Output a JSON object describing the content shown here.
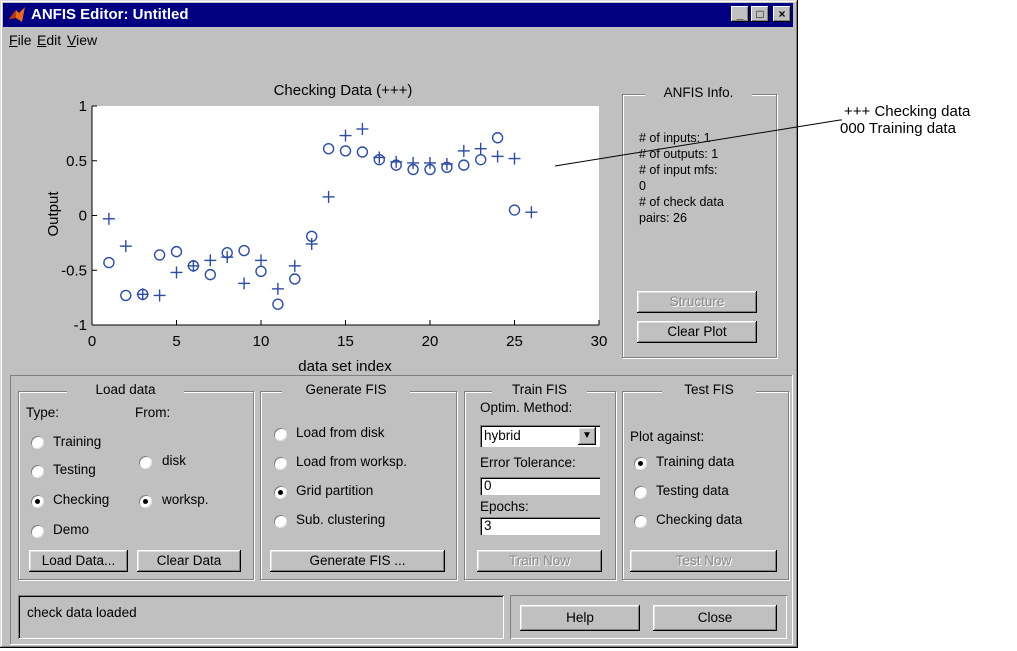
{
  "window": {
    "title": "ANFIS Editor: Untitled",
    "controls": [
      "_",
      "□",
      "×"
    ]
  },
  "menu": {
    "items": [
      "File",
      "Edit",
      "View"
    ]
  },
  "chart_data": {
    "type": "scatter",
    "title": "Checking Data (+++)",
    "xlabel": "data set index",
    "ylabel": "Output",
    "xlim": [
      0,
      30
    ],
    "ylim": [
      -1,
      1
    ],
    "xticks": [
      "0",
      "5",
      "10",
      "15",
      "20",
      "25",
      "30"
    ],
    "yticks": [
      "1",
      "0.5",
      "0",
      "-0.5",
      "-1"
    ],
    "series": [
      {
        "marker": "o",
        "x": [
          1,
          2,
          3,
          4,
          5,
          6,
          7,
          8,
          9,
          10,
          11,
          12,
          13,
          14,
          15,
          16,
          17,
          18,
          19,
          20,
          21,
          22,
          23,
          24,
          25
        ],
        "y": [
          -0.43,
          -0.73,
          -0.72,
          -0.36,
          -0.33,
          -0.46,
          -0.54,
          -0.34,
          -0.32,
          -0.51,
          -0.81,
          -0.58,
          -0.19,
          0.61,
          0.59,
          0.58,
          0.51,
          0.46,
          0.42,
          0.42,
          0.44,
          0.46,
          0.51,
          0.71,
          0.05
        ]
      },
      {
        "marker": "+",
        "x": [
          1,
          2,
          3,
          4,
          5,
          6,
          7,
          8,
          9,
          10,
          11,
          12,
          13,
          14,
          15,
          16,
          17,
          18,
          19,
          20,
          21,
          22,
          23,
          24,
          25,
          26
        ],
        "y": [
          -0.03,
          -0.28,
          -0.72,
          -0.73,
          -0.52,
          -0.46,
          -0.41,
          -0.38,
          -0.62,
          -0.41,
          -0.67,
          -0.46,
          -0.26,
          0.17,
          0.73,
          0.79,
          0.53,
          0.49,
          0.48,
          0.48,
          0.47,
          0.59,
          0.61,
          0.54,
          0.52,
          0.03
        ]
      }
    ],
    "grid": false
  },
  "legend": {
    "checking": "+++ Checking data",
    "training": "000 Training data"
  },
  "anfis_info": {
    "title": "ANFIS Info.",
    "lines": [
      "# of inputs: 1",
      "# of outputs: 1",
      "# of input mfs:",
      "0",
      "# of check data",
      "pairs: 26"
    ],
    "structure_btn": "Structure",
    "clear_plot_btn": "Clear Plot"
  },
  "load_data": {
    "title": "Load data",
    "type_label": "Type:",
    "from_label": "From:",
    "types": [
      "Training",
      "Testing",
      "Checking",
      "Demo"
    ],
    "selected_type": "Checking",
    "from_options": [
      "disk",
      "worksp."
    ],
    "selected_from": "worksp.",
    "load_btn": "Load Data...",
    "clear_btn": "Clear Data"
  },
  "generate_fis": {
    "title": "Generate FIS",
    "options": [
      "Load from disk",
      "Load from worksp.",
      "Grid partition",
      "Sub. clustering"
    ],
    "selected": "Grid partition",
    "btn": "Generate FIS ..."
  },
  "train_fis": {
    "title": "Train FIS",
    "method_label": "Optim. Method:",
    "method_value": "hybrid",
    "tol_label": "Error Tolerance:",
    "tol_value": "0",
    "epochs_label": "Epochs:",
    "epochs_value": "3",
    "btn": "Train Now"
  },
  "test_fis": {
    "title": "Test FIS",
    "plot_label": "Plot against:",
    "options": [
      "Training data",
      "Testing data",
      "Checking data"
    ],
    "selected": "Training data",
    "btn": "Test Now"
  },
  "status": {
    "text": "check data loaded"
  },
  "footer": {
    "help_btn": "Help",
    "close_btn": "Close"
  }
}
